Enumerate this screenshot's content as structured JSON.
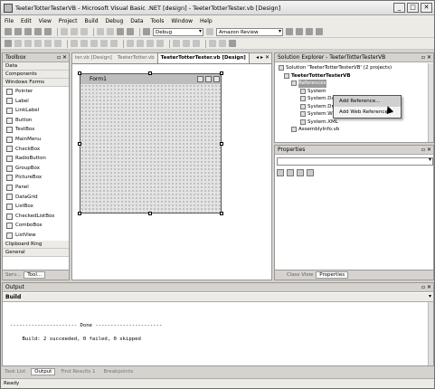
{
  "window": {
    "title": "TeeterTotterTesterVB - Microsoft Visual Basic .NET [design] - TeeterTotterTester.vb [Design]",
    "min": "_",
    "max": "□",
    "close": "✕"
  },
  "menu": [
    "File",
    "Edit",
    "View",
    "Project",
    "Build",
    "Debug",
    "Data",
    "Tools",
    "Window",
    "Help"
  ],
  "toolbar": {
    "config": "Debug",
    "find": "Amazon Review"
  },
  "toolbox": {
    "title": "Toolbox",
    "pin": "▫ ✕",
    "categories_top": [
      "Data",
      "Components",
      "Windows Forms"
    ],
    "items": [
      "Pointer",
      "Label",
      "LinkLabel",
      "Button",
      "TextBox",
      "MainMenu",
      "CheckBox",
      "RadioButton",
      "GroupBox",
      "PictureBox",
      "Panel",
      "DataGrid",
      "ListBox",
      "CheckedListBox",
      "ComboBox",
      "ListView"
    ],
    "categories_bottom": [
      "Clipboard Ring",
      "General"
    ],
    "footer_tabs": [
      "Serv...",
      "Tool..."
    ]
  },
  "document": {
    "tabs": [
      "ter.vb [Design]",
      "TeeterTotter.vb",
      "TeeterTotterTester.vb [Design]"
    ],
    "nav": "◂ ▸ ✕",
    "form_title": "Form1"
  },
  "solution_explorer": {
    "title": "Solution Explorer - TeeterTotterTesterVB",
    "pin": "▫ ✕",
    "nodes": [
      "Solution 'TeeterTotterTesterVB' (2 projects)",
      "TeeterTotterTesterVB",
      "References",
      "System",
      "System.Data",
      "System.Drawing",
      "System.Windows.Forms",
      "System.XML",
      "AssemblyInfo.vb"
    ],
    "context_menu": [
      "Add Reference...",
      "Add Web Reference..."
    ]
  },
  "properties": {
    "title": "Properties",
    "pin": "▫ ✕",
    "footer_tabs": [
      "Class View",
      "Properties"
    ]
  },
  "output": {
    "title": "Output",
    "pin": "▫ ✕",
    "selector": "Build",
    "line1": "---------------------- Done ----------------------",
    "line2": "    Build: 2 succeeded, 0 failed, 0 skipped",
    "tabs": [
      "Task List",
      "Output",
      "Find Results 1",
      "Breakpoints"
    ]
  },
  "status": "Ready"
}
